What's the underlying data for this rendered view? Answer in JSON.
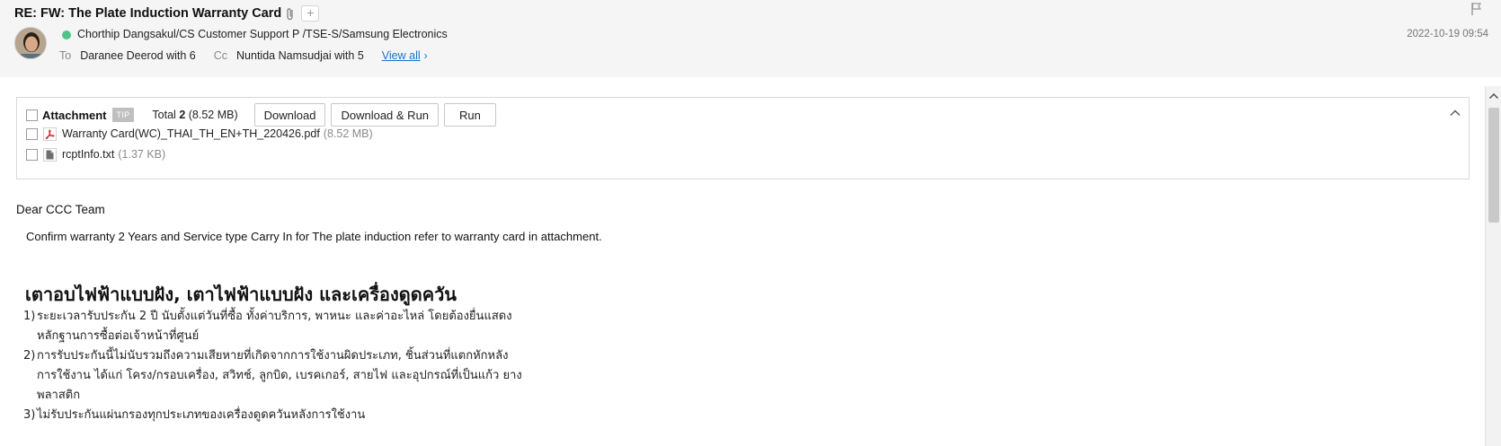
{
  "email": {
    "subject": "RE: FW: The Plate Induction Warranty Card",
    "sender": "Chorthip Dangsakul/CS Customer Support P /TSE-S/Samsung Electronics",
    "date": "2022-10-19 09:54",
    "to_label": "To",
    "to_value": "Daranee Deerod with 6",
    "cc_label": "Cc",
    "cc_value": "Nuntida Namsudjai with 5",
    "view_all": "View all"
  },
  "attachments": {
    "title": "Attachment",
    "tip": "TIP",
    "total_label": "Total",
    "total_count": "2",
    "total_size": "(8.52 MB)",
    "buttons": {
      "download": "Download",
      "download_run": "Download & Run",
      "run": "Run"
    },
    "files": [
      {
        "name": "Warranty Card(WC)_THAI_TH_EN+TH_220426.pdf",
        "size": "(8.52 MB)",
        "icon": "pdf-icon"
      },
      {
        "name": "rcptInfo.txt",
        "size": "(1.37 KB)",
        "icon": "text-file-icon"
      }
    ]
  },
  "body": {
    "greeting": "Dear CCC Team",
    "line1": "Confirm warranty 2 Years and Service type Carry In for The plate induction refer to warranty card in attachment.",
    "thai_heading": "เตาอบไฟฟ้าแบบฝัง, เตาไฟฟ้าแบบฝัง และเครื่องดูดควัน",
    "thai_items": [
      {
        "num": "1)",
        "text": "ระยะเวลารับประกัน 2 ปี นับตั้งแต่วันที่ซื้อ ทั้งค่าบริการ, พาหนะ และค่าอะไหล่ โดยต้องยื่นแสดงหลักฐานการซื้อต่อเจ้าหน้าที่ศูนย์"
      },
      {
        "num": "2)",
        "text": "การรับประกันนี้ไม่นับรวมถึงความเสียหายที่เกิดจากการใช้งานผิดประเภท, ชิ้นส่วนที่แตกหักหลังการใช้งาน ได้แก่ โครง/กรอบเครื่อง, สวิทช์, ลูกบิด, เบรคเกอร์, สายไฟ และอุปกรณ์ที่เป็นแก้ว ยาง พลาสติก"
      },
      {
        "num": "3)",
        "text": "ไม่รับประกันแผ่นกรองทุกประเภทของเครื่องดูดควันหลังการใช้งาน"
      }
    ]
  },
  "colors": {
    "header_bg": "#f5f5f5",
    "link": "#1a73c7",
    "online": "#4fc486",
    "pdf": "#d32f2f"
  }
}
